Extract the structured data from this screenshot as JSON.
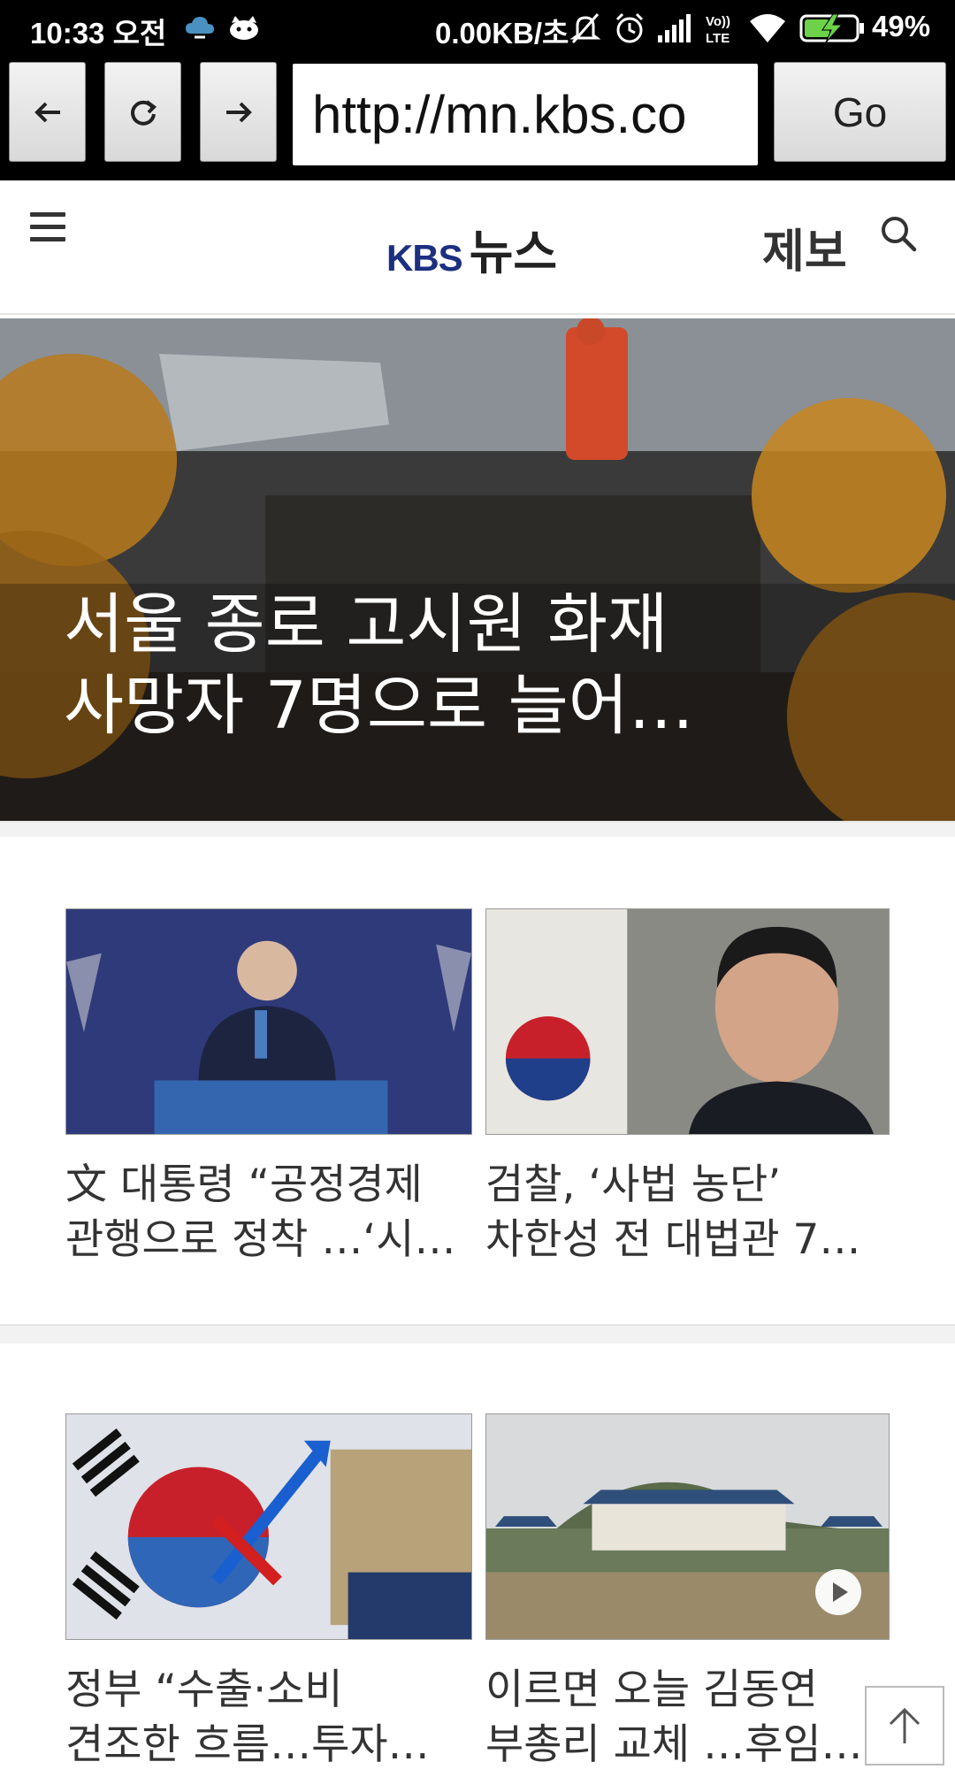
{
  "status_bar": {
    "time": "10:33 오전",
    "net_speed": "0.00KB/초",
    "battery": "49%"
  },
  "browser": {
    "back_icon": "arrow-left-icon",
    "reload_icon": "refresh-icon",
    "forward_icon": "arrow-right-icon",
    "url": "http://mn.kbs.co",
    "go_label": "Go"
  },
  "site": {
    "logo_kbs": "KBS",
    "logo_news": "뉴스",
    "report_label": "제보",
    "menu_icon": "hamburger-menu-icon",
    "search_icon": "search-icon"
  },
  "hero": {
    "headline": "서울 종로 고시원 화재\n사망자 7명으로 늘어…"
  },
  "articles": [
    {
      "headline": "文 대통령 “공정경제\n관행으로 정착 …‘시…"
    },
    {
      "headline": "검찰, ‘사법 농단’\n차한성 전 대법관 7…"
    },
    {
      "headline": "정부 “수출·소비\n견조한 흐름…투자…"
    },
    {
      "headline": "이르면 오늘 김동연\n부총리 교체 …후임…"
    }
  ],
  "colors": {
    "kbs_blue": "#1c2f80",
    "text_dark": "#333333"
  }
}
